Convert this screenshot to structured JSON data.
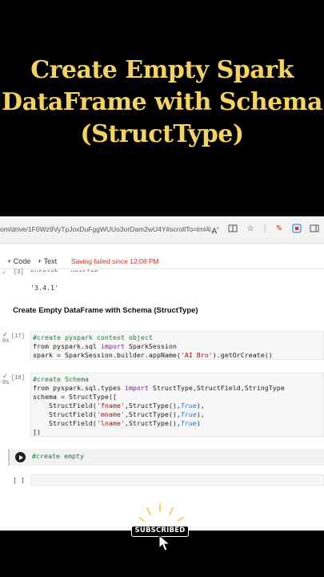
{
  "title": {
    "line1": "Create Empty Spark",
    "line2": "DataFrame with Schema",
    "line3": "(StructType)",
    "color": "#f4d35e"
  },
  "browser": {
    "url": "om/drive/1F0Wz9VyTpJoxDuFggWUUo3orDam2wU4Y#scrollTo=lml4l...",
    "icons": [
      "read-aloud-icon",
      "split-screen-icon",
      "favorite-star-icon",
      "pen-extension-icon",
      "extension-icon",
      "profile-icon"
    ]
  },
  "toolbar": {
    "add_code": "+ Code",
    "add_text": "+ Text",
    "status": "Saving failed since 12:08 PM"
  },
  "cells": {
    "c3_label": "[3]",
    "c3_partial": "pyspark.__version__",
    "c3_output": "'3.4.1'",
    "markdown_heading": "Create Empty DataFrame with Schema (StructType)",
    "c17_label": "[17]",
    "c17_meta": "0s",
    "c17_line1": "#create pyspark context object",
    "c17_line2a": "from pyspark.sql ",
    "c17_line2b": "import",
    "c17_line2c": " SparkSession",
    "c17_line3a": "spark = SparkSession.builder.appName(",
    "c17_line3b": "'AI Bro'",
    "c17_line3c": ").getOrCreate()",
    "c18_label": "[18]",
    "c18_meta": "0s",
    "c18_line1": "#create Schema",
    "c18_line2a": "from pyspark.sql.types ",
    "c18_line2b": "import",
    "c18_line2c": " StructType,StructField,StringType",
    "c18_line3": "schema = StructType([",
    "c18_f1a": "    StructField(",
    "c18_f1b": "'fname'",
    "c18_f1c": ",StructType(),",
    "c18_f1d": "True",
    "c18_f1e": "),",
    "c18_f2a": "    StructField(",
    "c18_f2b": "'mname'",
    "c18_f2c": ",StructType(),",
    "c18_f2d": "True",
    "c18_f2e": "),",
    "c18_f3a": "    StructField(",
    "c18_f3b": "'lname'",
    "c18_f3c": ",StructType(),",
    "c18_f3d": "True",
    "c18_f3e": ")",
    "c18_close": "])",
    "active_text": "#create empty",
    "empty_label": "[ ]"
  },
  "badge": {
    "subscribed": "SUBSCRIBED"
  }
}
